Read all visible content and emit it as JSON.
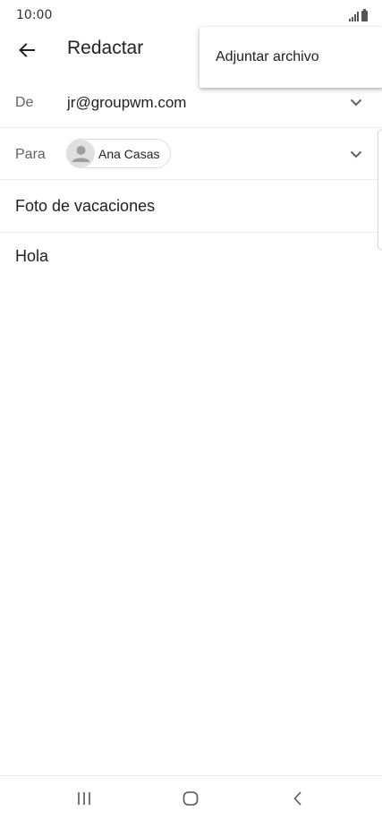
{
  "status_bar": {
    "time": "10:00",
    "icons": [
      "signal-icon",
      "battery-icon"
    ]
  },
  "header": {
    "title": "Redactar",
    "back_icon": "arrow-back-icon"
  },
  "overflow_menu": {
    "items": [
      {
        "label": "Adjuntar archivo"
      }
    ]
  },
  "from": {
    "label": "De",
    "value": "jr@groupwm.com"
  },
  "to": {
    "label": "Para",
    "recipients": [
      {
        "name": "Ana Casas",
        "icon": "person-icon"
      }
    ]
  },
  "subject": {
    "value": "Foto de vacaciones"
  },
  "body": {
    "value": "Hola"
  },
  "nav_bar": {
    "buttons": [
      "recents-icon",
      "home-icon",
      "back-icon"
    ]
  },
  "colors": {
    "text_primary": "#202124",
    "text_secondary": "#5f6368",
    "divider": "#ececec",
    "chip_border": "#dadce0"
  }
}
